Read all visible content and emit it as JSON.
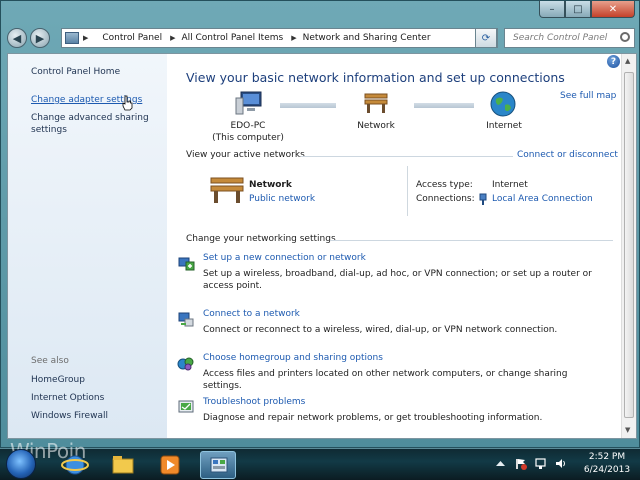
{
  "window": {
    "close_glyph": "✕",
    "max_glyph": "□",
    "min_glyph": "–"
  },
  "address_bar": {
    "crumbs": [
      "Control Panel",
      "All Control Panel Items",
      "Network and Sharing Center"
    ],
    "search_placeholder": "Search Control Panel"
  },
  "left_pane": {
    "home": "Control Panel Home",
    "change_adapter": "Change adapter settings",
    "change_advanced_line1": "Change advanced sharing",
    "change_advanced_line2": "settings",
    "see_also": "See also",
    "homegroup": "HomeGroup",
    "internet_options": "Internet Options",
    "windows_firewall": "Windows Firewall"
  },
  "main": {
    "title": "View your basic network information and set up connections",
    "see_full_map": "See full map",
    "map": {
      "computer_name": "EDO-PC",
      "computer_sub": "(This computer)",
      "network": "Network",
      "internet": "Internet"
    },
    "active_networks": {
      "label": "View your active networks",
      "connect_link": "Connect or disconnect",
      "network_name": "Network",
      "network_type": "Public network",
      "access_type_label": "Access type:",
      "access_type_value": "Internet",
      "connections_label": "Connections:",
      "connections_value": "Local Area Connection"
    },
    "change_settings_label": "Change your networking settings",
    "tasks": [
      {
        "title": "Set up a new connection or network",
        "desc": "Set up a wireless, broadband, dial-up, ad hoc, or VPN connection; or set up a router or access point."
      },
      {
        "title": "Connect to a network",
        "desc": "Connect or reconnect to a wireless, wired, dial-up, or VPN network connection."
      },
      {
        "title": "Choose homegroup and sharing options",
        "desc": "Access files and printers located on other network computers, or change sharing settings."
      },
      {
        "title": "Troubleshoot problems",
        "desc": "Diagnose and repair network problems, or get troubleshooting information."
      }
    ]
  },
  "taskbar": {
    "time": "2:52 PM",
    "date": "6/24/2013",
    "watermark": "WinPoin"
  },
  "colors": {
    "link": "#1d5ab0",
    "title": "#1d3f7c",
    "left_pane": "#e6eff8"
  }
}
